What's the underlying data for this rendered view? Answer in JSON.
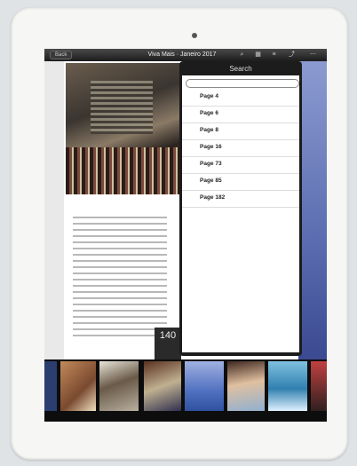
{
  "topbar": {
    "back_label": "Back",
    "title": "Viva Mais · Janeiro 2017"
  },
  "search": {
    "title": "Search",
    "placeholder": ""
  },
  "results": [
    {
      "label": "Page 4",
      "mark": "",
      "chevron": ""
    },
    {
      "label": "Page 6",
      "mark": "",
      "chevron": ""
    },
    {
      "label": "Page 8",
      "mark": "",
      "chevron": ""
    },
    {
      "label": "Page 16",
      "mark": "",
      "chevron": ""
    },
    {
      "label": "Page 73",
      "mark": "",
      "chevron": ""
    },
    {
      "label": "Page 85",
      "mark": "",
      "chevron": ""
    },
    {
      "label": "Page 182",
      "mark": "",
      "chevron": ""
    }
  ],
  "page_badge": {
    "small": "",
    "number": "140"
  },
  "icons": {
    "search": "search-icon",
    "grid": "grid-icon",
    "list": "list-icon",
    "share": "share-icon",
    "more": "more-icon"
  },
  "colors": {
    "bar": "#1c1c1c",
    "popover_bg": "#1c1c1c",
    "accent_blue": "#5b6cb0"
  }
}
